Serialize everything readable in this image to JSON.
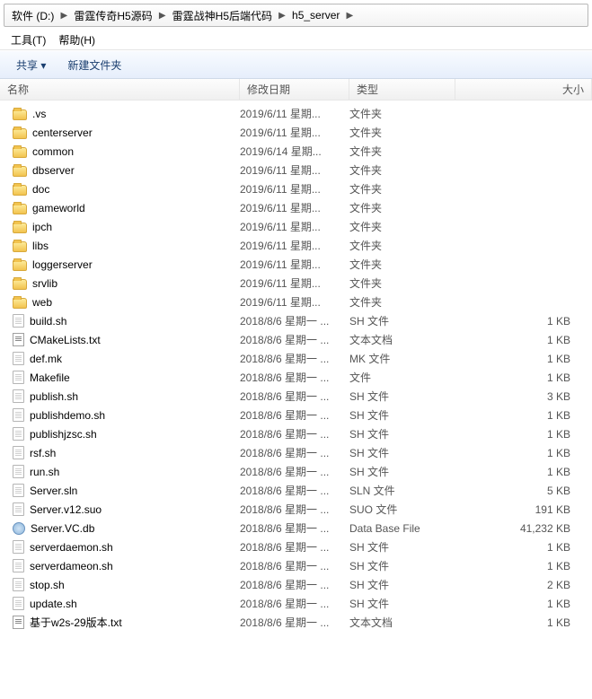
{
  "breadcrumb": {
    "root": "软件 (D:)",
    "p1": "雷霆传奇H5源码",
    "p2": "雷霆战神H5后端代码",
    "p3": "h5_server"
  },
  "menubar": {
    "tools": "工具(T)",
    "help": "帮助(H)"
  },
  "toolbar": {
    "share": "共享 ▾",
    "newfolder": "新建文件夹"
  },
  "headers": {
    "name": "名称",
    "date": "修改日期",
    "type": "类型",
    "size": "大小"
  },
  "rows": [
    {
      "icon": "folder",
      "name": ".vs",
      "date": "2019/6/11 星期...",
      "type": "文件夹",
      "size": ""
    },
    {
      "icon": "folder",
      "name": "centerserver",
      "date": "2019/6/11 星期...",
      "type": "文件夹",
      "size": ""
    },
    {
      "icon": "folder",
      "name": "common",
      "date": "2019/6/14 星期...",
      "type": "文件夹",
      "size": ""
    },
    {
      "icon": "folder",
      "name": "dbserver",
      "date": "2019/6/11 星期...",
      "type": "文件夹",
      "size": ""
    },
    {
      "icon": "folder",
      "name": "doc",
      "date": "2019/6/11 星期...",
      "type": "文件夹",
      "size": ""
    },
    {
      "icon": "folder",
      "name": "gameworld",
      "date": "2019/6/11 星期...",
      "type": "文件夹",
      "size": ""
    },
    {
      "icon": "folder",
      "name": "ipch",
      "date": "2019/6/11 星期...",
      "type": "文件夹",
      "size": ""
    },
    {
      "icon": "folder",
      "name": "libs",
      "date": "2019/6/11 星期...",
      "type": "文件夹",
      "size": ""
    },
    {
      "icon": "folder",
      "name": "loggerserver",
      "date": "2019/6/11 星期...",
      "type": "文件夹",
      "size": ""
    },
    {
      "icon": "folder",
      "name": "srvlib",
      "date": "2019/6/11 星期...",
      "type": "文件夹",
      "size": ""
    },
    {
      "icon": "folder",
      "name": "web",
      "date": "2019/6/11 星期...",
      "type": "文件夹",
      "size": ""
    },
    {
      "icon": "file",
      "name": "build.sh",
      "date": "2018/8/6 星期一 ...",
      "type": "SH 文件",
      "size": "1 KB"
    },
    {
      "icon": "txt",
      "name": "CMakeLists.txt",
      "date": "2018/8/6 星期一 ...",
      "type": "文本文档",
      "size": "1 KB"
    },
    {
      "icon": "file",
      "name": "def.mk",
      "date": "2018/8/6 星期一 ...",
      "type": "MK 文件",
      "size": "1 KB"
    },
    {
      "icon": "file",
      "name": "Makefile",
      "date": "2018/8/6 星期一 ...",
      "type": "文件",
      "size": "1 KB"
    },
    {
      "icon": "file",
      "name": "publish.sh",
      "date": "2018/8/6 星期一 ...",
      "type": "SH 文件",
      "size": "3 KB"
    },
    {
      "icon": "file",
      "name": "publishdemo.sh",
      "date": "2018/8/6 星期一 ...",
      "type": "SH 文件",
      "size": "1 KB"
    },
    {
      "icon": "file",
      "name": "publishjzsc.sh",
      "date": "2018/8/6 星期一 ...",
      "type": "SH 文件",
      "size": "1 KB"
    },
    {
      "icon": "file",
      "name": "rsf.sh",
      "date": "2018/8/6 星期一 ...",
      "type": "SH 文件",
      "size": "1 KB"
    },
    {
      "icon": "file",
      "name": "run.sh",
      "date": "2018/8/6 星期一 ...",
      "type": "SH 文件",
      "size": "1 KB"
    },
    {
      "icon": "file",
      "name": "Server.sln",
      "date": "2018/8/6 星期一 ...",
      "type": "SLN 文件",
      "size": "5 KB"
    },
    {
      "icon": "file",
      "name": "Server.v12.suo",
      "date": "2018/8/6 星期一 ...",
      "type": "SUO 文件",
      "size": "191 KB"
    },
    {
      "icon": "db",
      "name": "Server.VC.db",
      "date": "2018/8/6 星期一 ...",
      "type": "Data Base File",
      "size": "41,232 KB"
    },
    {
      "icon": "file",
      "name": "serverdaemon.sh",
      "date": "2018/8/6 星期一 ...",
      "type": "SH 文件",
      "size": "1 KB"
    },
    {
      "icon": "file",
      "name": "serverdameon.sh",
      "date": "2018/8/6 星期一 ...",
      "type": "SH 文件",
      "size": "1 KB"
    },
    {
      "icon": "file",
      "name": "stop.sh",
      "date": "2018/8/6 星期一 ...",
      "type": "SH 文件",
      "size": "2 KB"
    },
    {
      "icon": "file",
      "name": "update.sh",
      "date": "2018/8/6 星期一 ...",
      "type": "SH 文件",
      "size": "1 KB"
    },
    {
      "icon": "txt",
      "name": "基于w2s-29版本.txt",
      "date": "2018/8/6 星期一 ...",
      "type": "文本文档",
      "size": "1 KB"
    }
  ]
}
